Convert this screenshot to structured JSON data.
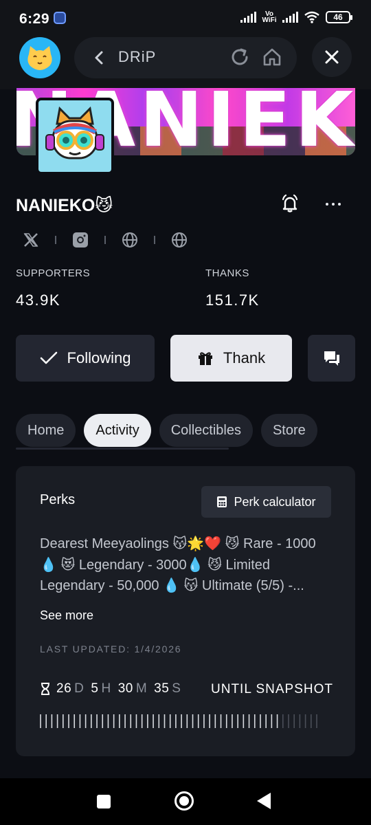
{
  "status": {
    "time": "6:29",
    "network_label": "Vo WiFi",
    "battery": "46"
  },
  "browser": {
    "page_title": "DRiP",
    "avatar_icon": "cat-face-emoji"
  },
  "banner": {
    "text": "NANIEKO"
  },
  "profile": {
    "name": "NANIEKO😼",
    "socials": [
      "x-icon",
      "instagram-icon",
      "globe-icon",
      "globe-icon"
    ]
  },
  "stats": {
    "supporters_label": "SUPPORTERS",
    "supporters_value": "43.9K",
    "thanks_label": "THANKS",
    "thanks_value": "151.7K"
  },
  "actions": {
    "following_label": "Following",
    "thank_label": "Thank"
  },
  "tabs": [
    {
      "label": "Home"
    },
    {
      "label": "Activity",
      "active": true
    },
    {
      "label": "Collectibles"
    },
    {
      "label": "Store"
    }
  ],
  "perks": {
    "title": "Perks",
    "calculator_label": "Perk calculator",
    "description": "Dearest Meeyaolings 😽🌟❤️ 😼 Rare - 1000 💧 😻 Legendary - 3000💧 😼 Limited Legendary - 50,000 💧 😽 Ultimate (5/5) -...",
    "see_more": "See more",
    "last_updated": "LAST UPDATED: 1/4/2026"
  },
  "countdown": {
    "days": "26",
    "days_unit": "D",
    "hours": "5",
    "hours_unit": "H",
    "minutes": "30",
    "minutes_unit": "M",
    "seconds": "35",
    "seconds_unit": "S",
    "label": "UNTIL SNAPSHOT",
    "progress_fraction": 0.86
  },
  "colors": {
    "background": "#0c0e14",
    "card": "#1a1d24",
    "button_dark": "#232631",
    "button_light": "#e8e9ee"
  }
}
